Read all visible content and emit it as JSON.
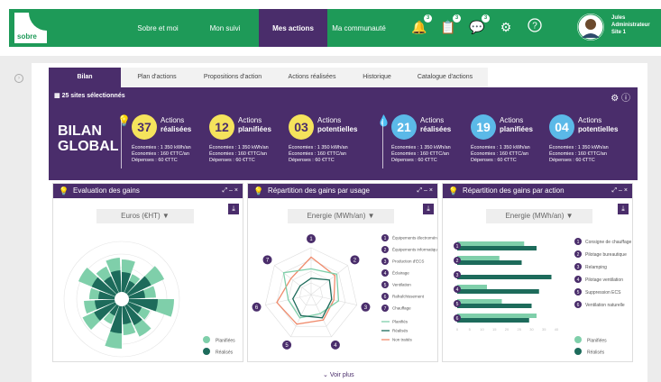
{
  "header": {
    "logo": "sobre",
    "nav": [
      "Sobre et moi",
      "Mon suivi",
      "Mes actions",
      "Ma communauté"
    ],
    "badges": [
      "3",
      "3",
      "3"
    ],
    "user": [
      "Jules",
      "Administrateur",
      "Site 1"
    ]
  },
  "tabs": [
    "Bilan",
    "Plan d'actions",
    "Propositions d'action",
    "Actions réalisées",
    "Historique",
    "Catalogue d'actions"
  ],
  "summary": {
    "sites": "25 sites sélectionnés",
    "title_line1": "BILAN",
    "title_line2": "GLOBAL",
    "stats": [
      {
        "value": "37",
        "label1": "Actions",
        "label2": "réalisées"
      },
      {
        "value": "12",
        "label1": "Actions",
        "label2": "planifiées"
      },
      {
        "value": "03",
        "label1": "Actions",
        "label2": "potentielles"
      },
      {
        "value": "21",
        "label1": "Actions",
        "label2": "réalisées"
      },
      {
        "value": "19",
        "label1": "Actions",
        "label2": "planifiées"
      },
      {
        "value": "04",
        "label1": "Actions",
        "label2": "potentielles"
      }
    ],
    "detail": [
      "Économies : 1 350 kWh/an",
      "Économies : 160 €TTC/an",
      "Dépenses : 60 €TTC"
    ],
    "colors": {
      "yellow": "#f5e35c",
      "blue": "#5bb9e8",
      "purple": "#4a2d6b"
    }
  },
  "panels": [
    {
      "title": "Evaluation des gains",
      "dropdown": "Euros (€HT)"
    },
    {
      "title": "Répartition des gains par usage",
      "dropdown": "Energie (MWh/an)"
    },
    {
      "title": "Répartition des gains par action",
      "dropdown": "Energie (MWh/an)"
    }
  ],
  "legend_basic": [
    "Planifiées",
    "Réalisés"
  ],
  "radar_legend": [
    "Équipements électroménagers",
    "Équipements informatiques",
    "Production d'ECS",
    "Éclairage",
    "Ventilation",
    "Rafraîchissement",
    "Chauffage"
  ],
  "radar_lines": [
    "Planifiés",
    "Réalisés",
    "Non traités"
  ],
  "radar_axis_numbers": [
    "1",
    "2",
    "3",
    "4",
    "5",
    "6",
    "7"
  ],
  "bar_legend": [
    "Consigne de chauffage",
    "Pilotage bureautique",
    "Relamping",
    "Pilotage ventilation",
    "Suppression ECS",
    "Ventilation naturelle"
  ],
  "chart_data": [
    {
      "type": "area",
      "title": "Evaluation des gains",
      "series": [
        {
          "name": "Planifiées"
        },
        {
          "name": "Réalisés"
        }
      ]
    },
    {
      "type": "scatter",
      "title": "Répartition des gains par usage",
      "categories": [
        "1",
        "2",
        "3",
        "4",
        "5",
        "6",
        "7"
      ],
      "series": [
        {
          "name": "Planifiés"
        },
        {
          "name": "Réalisés"
        },
        {
          "name": "Non traités"
        }
      ]
    },
    {
      "type": "bar",
      "title": "Répartition des gains par action",
      "categories": [
        "1",
        "2",
        "3",
        "4",
        "5",
        "6"
      ],
      "series": [
        {
          "name": "Planifiées",
          "values": [
            27,
            17,
            0,
            12,
            18,
            32
          ]
        },
        {
          "name": "Réalisés",
          "values": [
            32,
            26,
            38,
            33,
            30,
            29
          ]
        }
      ],
      "xlim": [
        0,
        40
      ],
      "xticks": [
        "0",
        "5",
        "10",
        "15",
        "20",
        "25",
        "30",
        "35",
        "40"
      ]
    }
  ],
  "voir_plus": "Voir plus"
}
